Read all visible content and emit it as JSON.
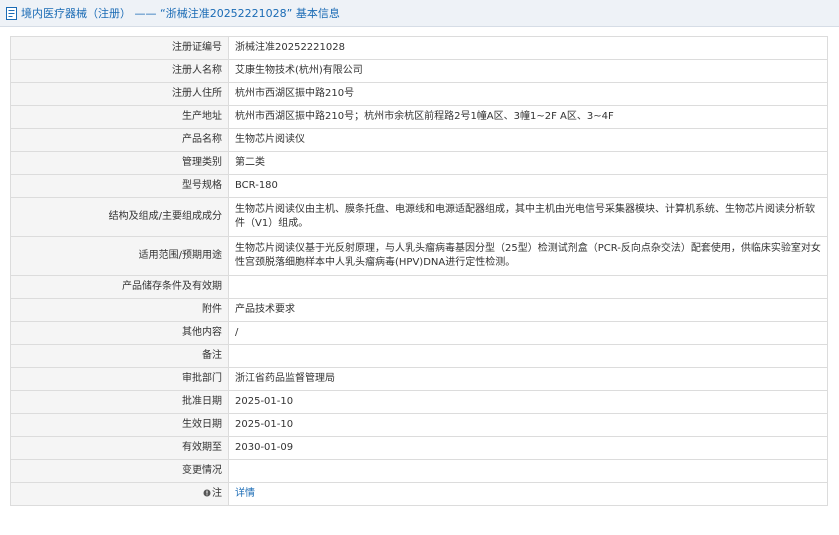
{
  "header": {
    "title": "境内医疗器械（注册） ——  “浙械注准20252221028” 基本信息",
    "icon": "document-icon"
  },
  "rows": [
    {
      "label": "注册证编号",
      "value": "浙械注准20252221028"
    },
    {
      "label": "注册人名称",
      "value": "艾康生物技术(杭州)有限公司"
    },
    {
      "label": "注册人住所",
      "value": "杭州市西湖区振中路210号"
    },
    {
      "label": "生产地址",
      "value": "杭州市西湖区振中路210号；杭州市余杭区前程路2号1幢A区、3幢1~2F A区、3~4F"
    },
    {
      "label": "产品名称",
      "value": "生物芯片阅读仪"
    },
    {
      "label": "管理类别",
      "value": "第二类"
    },
    {
      "label": "型号规格",
      "value": "BCR-180"
    },
    {
      "label": "结构及组成/主要组成成分",
      "value": "生物芯片阅读仪由主机、膜条托盘、电源线和电源适配器组成，其中主机由光电信号采集器模块、计算机系统、生物芯片阅读分析软件（V1）组成。"
    },
    {
      "label": "适用范围/预期用途",
      "value": "生物芯片阅读仪基于光反射原理，与人乳头瘤病毒基因分型（25型）检测试剂盒（PCR-反向点杂交法）配套使用，供临床实验室对女性宫颈脱落细胞样本中人乳头瘤病毒(HPV)DNA进行定性检测。"
    },
    {
      "label": "产品储存条件及有效期",
      "value": ""
    },
    {
      "label": "附件",
      "value": "产品技术要求"
    },
    {
      "label": "其他内容",
      "value": "/"
    },
    {
      "label": "备注",
      "value": ""
    },
    {
      "label": "审批部门",
      "value": "浙江省药品监督管理局"
    },
    {
      "label": "批准日期",
      "value": "2025-01-10"
    },
    {
      "label": "生效日期",
      "value": "2025-01-10"
    },
    {
      "label": "有效期至",
      "value": "2030-01-09"
    },
    {
      "label": "变更情况",
      "value": ""
    }
  ],
  "note": {
    "label": "注",
    "icon": "warning-icon",
    "link_text": "详情"
  },
  "colors": {
    "accent": "#1a6bb5",
    "label_bg": "#f5f5f5",
    "border": "#dcdcdc",
    "header_bg": "#eef2f7"
  }
}
